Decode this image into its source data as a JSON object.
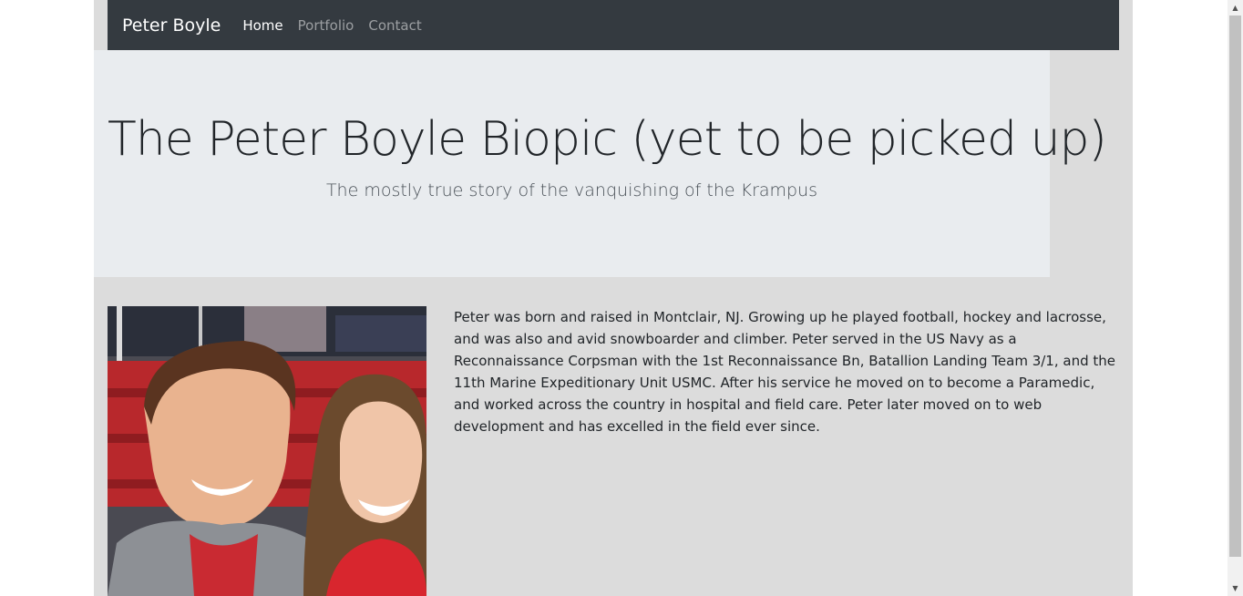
{
  "navbar": {
    "brand": "Peter Boyle",
    "links": [
      {
        "label": "Home",
        "active": true
      },
      {
        "label": "Portfolio",
        "active": false
      },
      {
        "label": "Contact",
        "active": false
      }
    ]
  },
  "hero": {
    "title": "The Peter Boyle Biopic (yet to be picked up)",
    "subtitle": "The mostly true story of the vanquishing of the Krampus"
  },
  "about": {
    "photo_icon": "profile-photo",
    "bio": "Peter was born and raised in Montclair, NJ. Growing up he played football, hockey and lacrosse, and was also and avid snowboarder and climber. Peter served in the US Navy as a Reconnaissance Corpsman with the 1st Reconnaissance Bn, Batallion Landing Team 3/1, and the 11th Marine Expeditionary Unit USMC. After his service he moved on to become a Paramedic, and worked across the country in hospital and field care. Peter later moved on to web development and has excelled in the field ever since."
  },
  "colors": {
    "navbar_bg": "#343a40",
    "jumbotron_bg": "#e9ecef",
    "container_bg": "#dcdcdc"
  }
}
